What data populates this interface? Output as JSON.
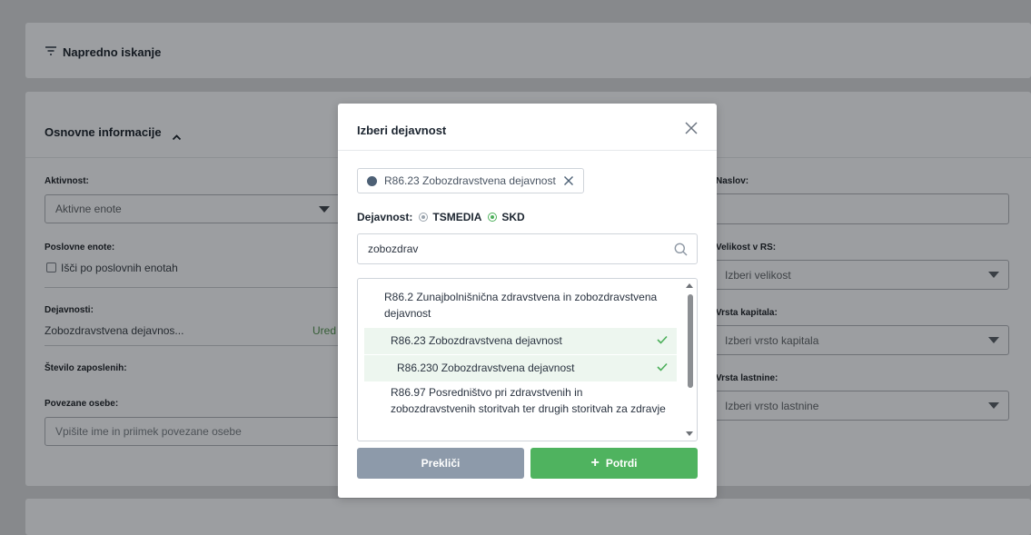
{
  "background": {
    "advanced_search": {
      "title": "Napredno iskanje"
    },
    "basic_info": {
      "title": "Osnovne informacije",
      "activity_label": "Aktivnost:",
      "activity_value": "Aktivne enote",
      "units_label": "Poslovne enote:",
      "units_checkbox": "Išči po poslovnih enotah",
      "activities_label": "Dejavnosti:",
      "activities_value": "Zobozdravstvena dejavnos...",
      "activities_edit": "Ured",
      "employees_label": "Število zaposlenih:",
      "persons_label": "Povezane osebe:",
      "persons_placeholder": "Vpišite ime in priimek povezane osebe",
      "address_label": "Naslov:",
      "size_label": "Velikost v RS:",
      "size_value": "Izberi velikost",
      "capital_label": "Vrsta kapitala:",
      "capital_value": "Izberi vrsto kapitala",
      "ownership_label": "Vrsta lastnine:",
      "ownership_value": "Izberi vrsto lastnine"
    }
  },
  "modal": {
    "title": "Izberi dejavnost",
    "chip": "R86.23 Zobozdravstvena dejavnost",
    "classification_label": "Dejavnost:",
    "options": [
      "TSMEDIA",
      "SKD"
    ],
    "selected_option": "SKD",
    "search_value": "zobozdrav",
    "results": [
      {
        "text": "R86.2 Zunajbolnišnična zdravstvena in zobozdravstvena dejavnost",
        "selected": false
      },
      {
        "text": "R86.23 Zobozdravstvena dejavnost",
        "selected": true
      },
      {
        "text": "R86.230 Zobozdravstvena dejavnost",
        "selected": true
      },
      {
        "text": "R86.97 Posredništvo pri zdravstvenih in zobozdravstvenih storitvah ter drugih storitvah za zdravje",
        "selected": false
      }
    ],
    "cancel_label": "Prekliči",
    "confirm_label": "Potrdi"
  },
  "colors": {
    "accent_green": "#4fb35f",
    "cancel_gray": "#8d9aaa"
  }
}
